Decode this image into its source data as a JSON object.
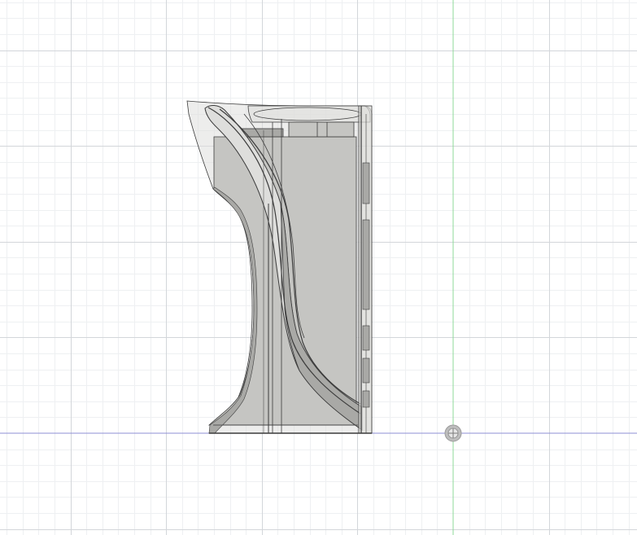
{
  "viewport": {
    "view": "side",
    "background": "#ffffff",
    "grid_minor_color": "#eef0f2",
    "grid_major_color": "#d3d6da",
    "x_axis_color": "#8e8fd6",
    "y_axis_color": "#8fd89a",
    "origin_marker": "origin-pivot-icon"
  },
  "model": {
    "body_fill": "#c5c5c2",
    "body_fill_dark": "#a9a9a6",
    "translucent_fill": "#dededc",
    "edge_color": "#3c3c3c"
  }
}
